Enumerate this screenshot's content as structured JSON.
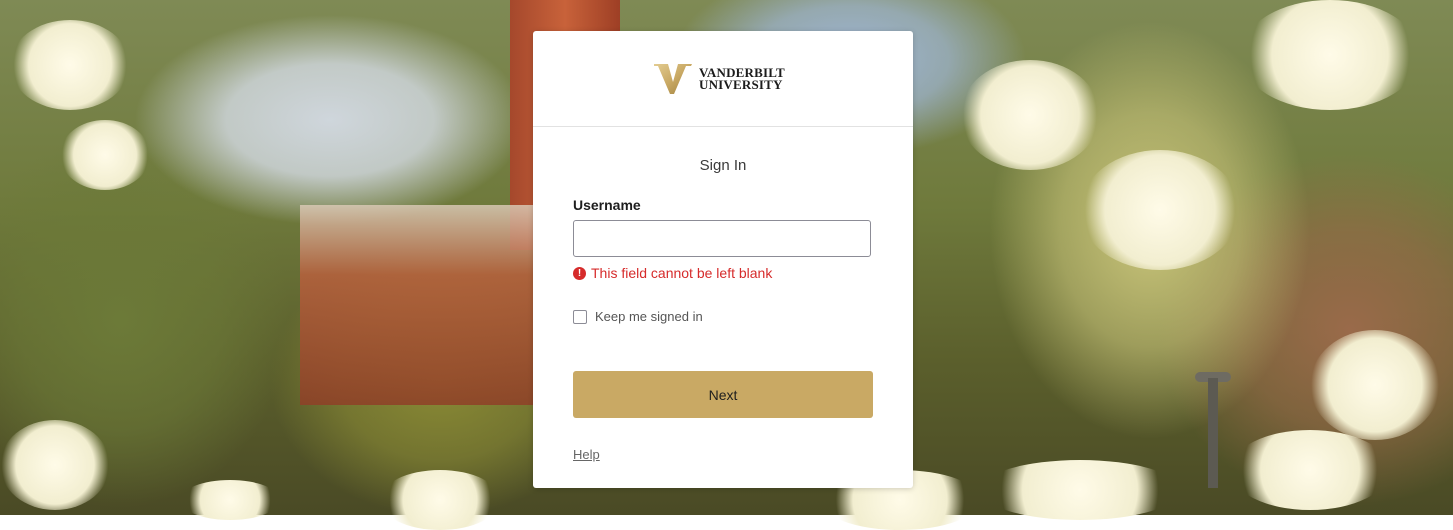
{
  "brand": {
    "line1": "VANDERBILT",
    "line2": "UNIVERSITY",
    "logo_icon": "vanderbilt-v-icon",
    "accent": "#c9a964"
  },
  "form": {
    "title": "Sign In",
    "username_label": "Username",
    "username_value": "",
    "error_text": "This field cannot be left blank",
    "error_icon": "alert-circle-icon",
    "error_color": "#d62b2b",
    "keep_signed_in_label": "Keep me signed in",
    "keep_signed_in_checked": false,
    "next_label": "Next",
    "help_label": "Help"
  }
}
